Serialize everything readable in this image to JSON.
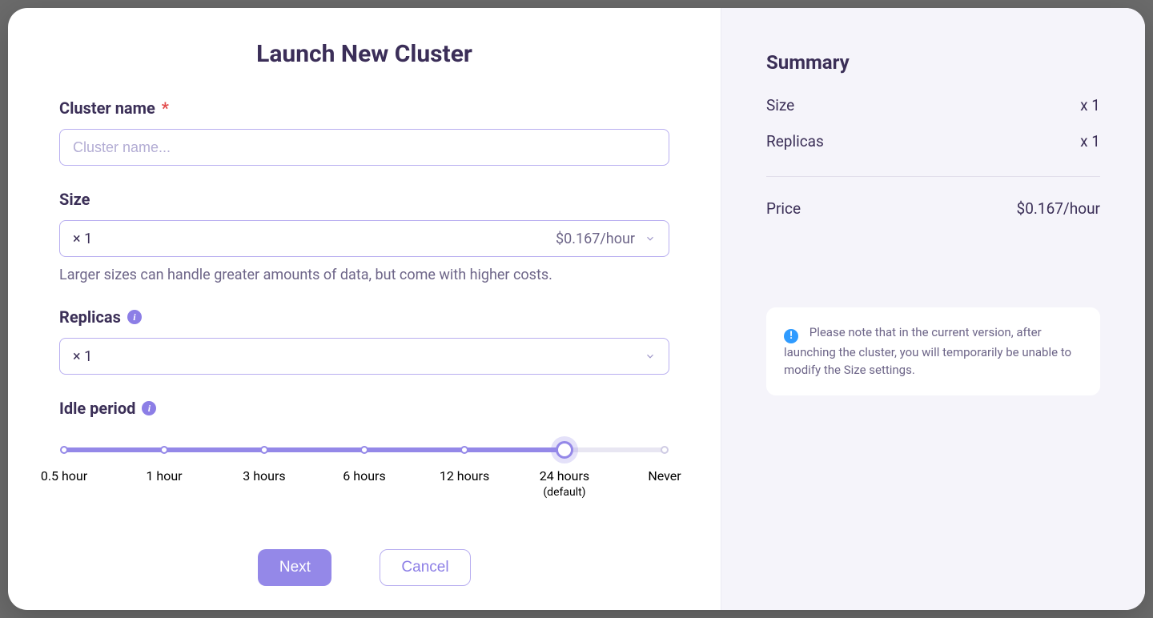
{
  "title": "Launch New Cluster",
  "fields": {
    "cluster_name": {
      "label": "Cluster name",
      "required_mark": "*",
      "placeholder": "Cluster name...",
      "value": ""
    },
    "size": {
      "label": "Size",
      "selected": "× 1",
      "price": "$0.167/hour",
      "helper": "Larger sizes can handle greater amounts of data, but come with higher costs."
    },
    "replicas": {
      "label": "Replicas",
      "selected": "× 1"
    },
    "idle_period": {
      "label": "Idle period",
      "options": [
        {
          "pos": 0,
          "label": "0.5 hour",
          "sub": ""
        },
        {
          "pos": 16.67,
          "label": "1 hour",
          "sub": ""
        },
        {
          "pos": 33.33,
          "label": "3 hours",
          "sub": ""
        },
        {
          "pos": 50.0,
          "label": "6 hours",
          "sub": ""
        },
        {
          "pos": 66.67,
          "label": "12 hours",
          "sub": ""
        },
        {
          "pos": 83.33,
          "label": "24 hours",
          "sub": "(default)"
        },
        {
          "pos": 100.0,
          "label": "Never",
          "sub": ""
        }
      ],
      "selected_index": 5
    }
  },
  "actions": {
    "primary": "Next",
    "secondary": "Cancel"
  },
  "summary": {
    "title": "Summary",
    "rows": {
      "size": {
        "label": "Size",
        "value": "x 1"
      },
      "replicas": {
        "label": "Replicas",
        "value": "x 1"
      },
      "price": {
        "label": "Price",
        "value": "$0.167/hour"
      }
    }
  },
  "notice": {
    "text": "Please note that in the current version, after launching the cluster, you will temporarily be unable to modify the Size settings."
  },
  "colors": {
    "accent": "#9488e8",
    "border": "#b8aef0",
    "text": "#3b2f57",
    "muted": "#6d6588",
    "panel_bg": "#f5f4fa",
    "info_blue": "#2f9bff"
  }
}
